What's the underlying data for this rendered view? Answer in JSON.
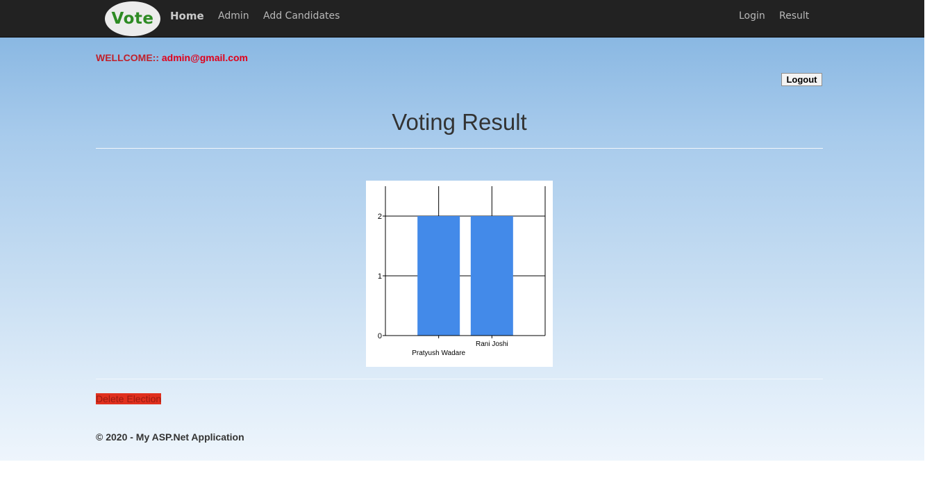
{
  "nav": {
    "logo_text": "Vote",
    "home": "Home",
    "admin": "Admin",
    "add_candidates": "Add Candidates",
    "login": "Login",
    "result": "Result"
  },
  "welcome": {
    "prefix": "WELLCOME:: ",
    "email": "admin@gmail.com"
  },
  "logout_label": "Logout",
  "page_title": "Voting Result",
  "chart_data": {
    "type": "bar",
    "categories": [
      "Pratyush Wadare",
      "Rani Joshi"
    ],
    "values": [
      2,
      2
    ],
    "ylim": [
      0,
      2.5
    ],
    "yticks": [
      0,
      1,
      2
    ],
    "grid": true,
    "bar_color": "#438ae9"
  },
  "delete_label": "Delete Election",
  "footer": "© 2020 - My ASP.Net Application"
}
